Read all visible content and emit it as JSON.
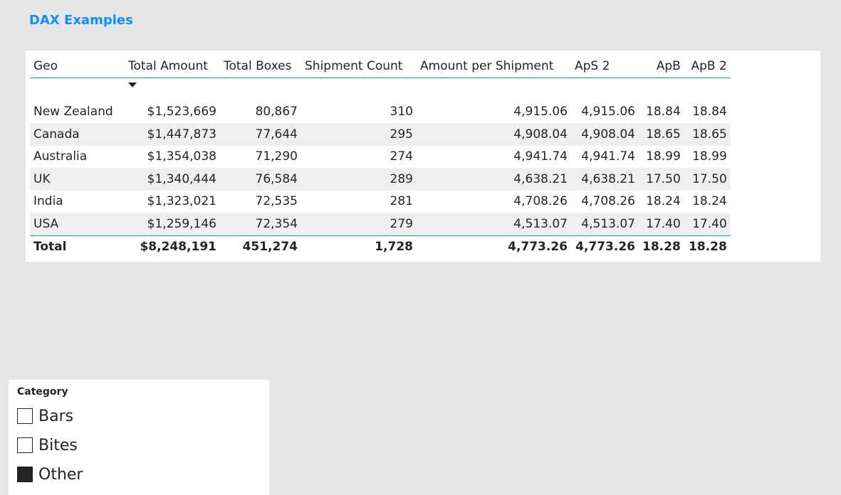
{
  "page": {
    "title": "DAX Examples"
  },
  "table": {
    "columns": [
      "Geo",
      "Total Amount",
      "Total Boxes",
      "Shipment Count",
      "Amount per Shipment",
      "ApS 2",
      "ApB",
      "ApB 2"
    ],
    "sort_column": "Total Amount",
    "sort_direction": "descending",
    "rows": [
      [
        "New Zealand",
        "$1,523,669",
        "80,867",
        "310",
        "4,915.06",
        "4,915.06",
        "18.84",
        "18.84"
      ],
      [
        "Canada",
        "$1,447,873",
        "77,644",
        "295",
        "4,908.04",
        "4,908.04",
        "18.65",
        "18.65"
      ],
      [
        "Australia",
        "$1,354,038",
        "71,290",
        "274",
        "4,941.74",
        "4,941.74",
        "18.99",
        "18.99"
      ],
      [
        "UK",
        "$1,340,444",
        "76,584",
        "289",
        "4,638.21",
        "4,638.21",
        "17.50",
        "17.50"
      ],
      [
        "India",
        "$1,323,021",
        "72,535",
        "281",
        "4,708.26",
        "4,708.26",
        "18.24",
        "18.24"
      ],
      [
        "USA",
        "$1,259,146",
        "72,354",
        "279",
        "4,513.07",
        "4,513.07",
        "17.40",
        "17.40"
      ]
    ],
    "total": [
      "Total",
      "$8,248,191",
      "451,274",
      "1,728",
      "4,773.26",
      "4,773.26",
      "18.28",
      "18.28"
    ]
  },
  "slicer": {
    "header": "Category",
    "items": [
      {
        "label": "Bars",
        "checked": false
      },
      {
        "label": "Bites",
        "checked": false
      },
      {
        "label": "Other",
        "checked": true
      }
    ]
  },
  "colors": {
    "accent": "#118dff",
    "canvas": "#e6e6e6",
    "row_band": "#efefef",
    "text": "#252423"
  }
}
